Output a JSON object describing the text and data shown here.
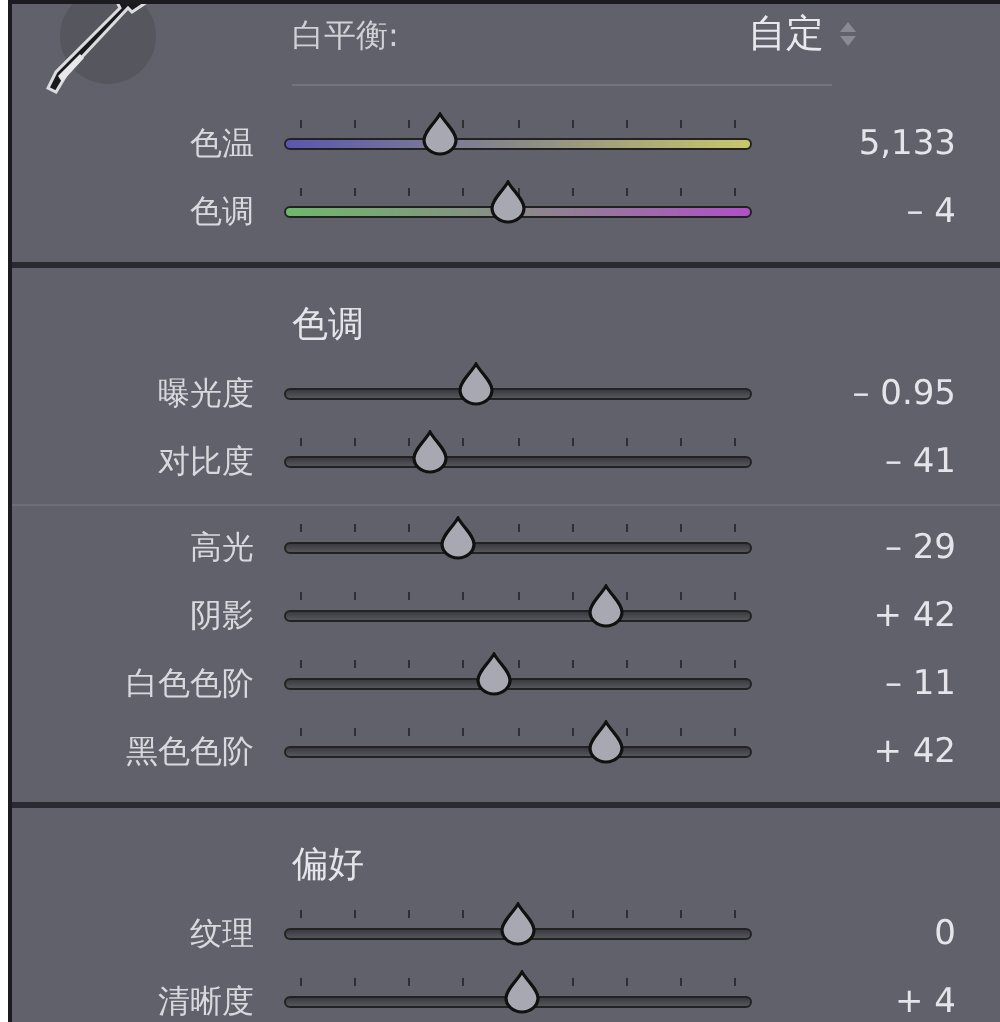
{
  "white_balance": {
    "label": "白平衡:",
    "value": "自定"
  },
  "sections": [
    {
      "groups": [
        [
          {
            "label": "色温",
            "kind": "temperature",
            "ticks": true,
            "level": 0.33,
            "reading": "5,133"
          },
          {
            "label": "色调",
            "kind": "tint",
            "ticks": true,
            "level": 0.48,
            "reading": "– 4"
          }
        ]
      ]
    },
    {
      "heading": "色调",
      "groups": [
        [
          {
            "label": "曝光度",
            "kind": "plain",
            "ticks": false,
            "level": 0.41,
            "reading": "– 0.95"
          },
          {
            "label": "对比度",
            "kind": "plain",
            "ticks": true,
            "level": 0.31,
            "reading": "– 41"
          }
        ],
        [
          {
            "label": "高光",
            "kind": "plain",
            "ticks": true,
            "level": 0.37,
            "reading": "– 29"
          },
          {
            "label": "阴影",
            "kind": "plain",
            "ticks": true,
            "level": 0.69,
            "reading": "+ 42"
          },
          {
            "label": "白色色阶",
            "kind": "plain",
            "ticks": true,
            "level": 0.45,
            "reading": "– 11"
          },
          {
            "label": "黑色色阶",
            "kind": "plain",
            "ticks": true,
            "level": 0.69,
            "reading": "+ 42"
          }
        ]
      ]
    },
    {
      "heading": "偏好",
      "groups": [
        [
          {
            "label": "纹理",
            "kind": "plain",
            "ticks": true,
            "level": 0.5,
            "reading": "0"
          },
          {
            "label": "清晰度",
            "kind": "plain",
            "ticks": true,
            "level": 0.51,
            "reading": "+ 4"
          }
        ]
      ]
    }
  ]
}
